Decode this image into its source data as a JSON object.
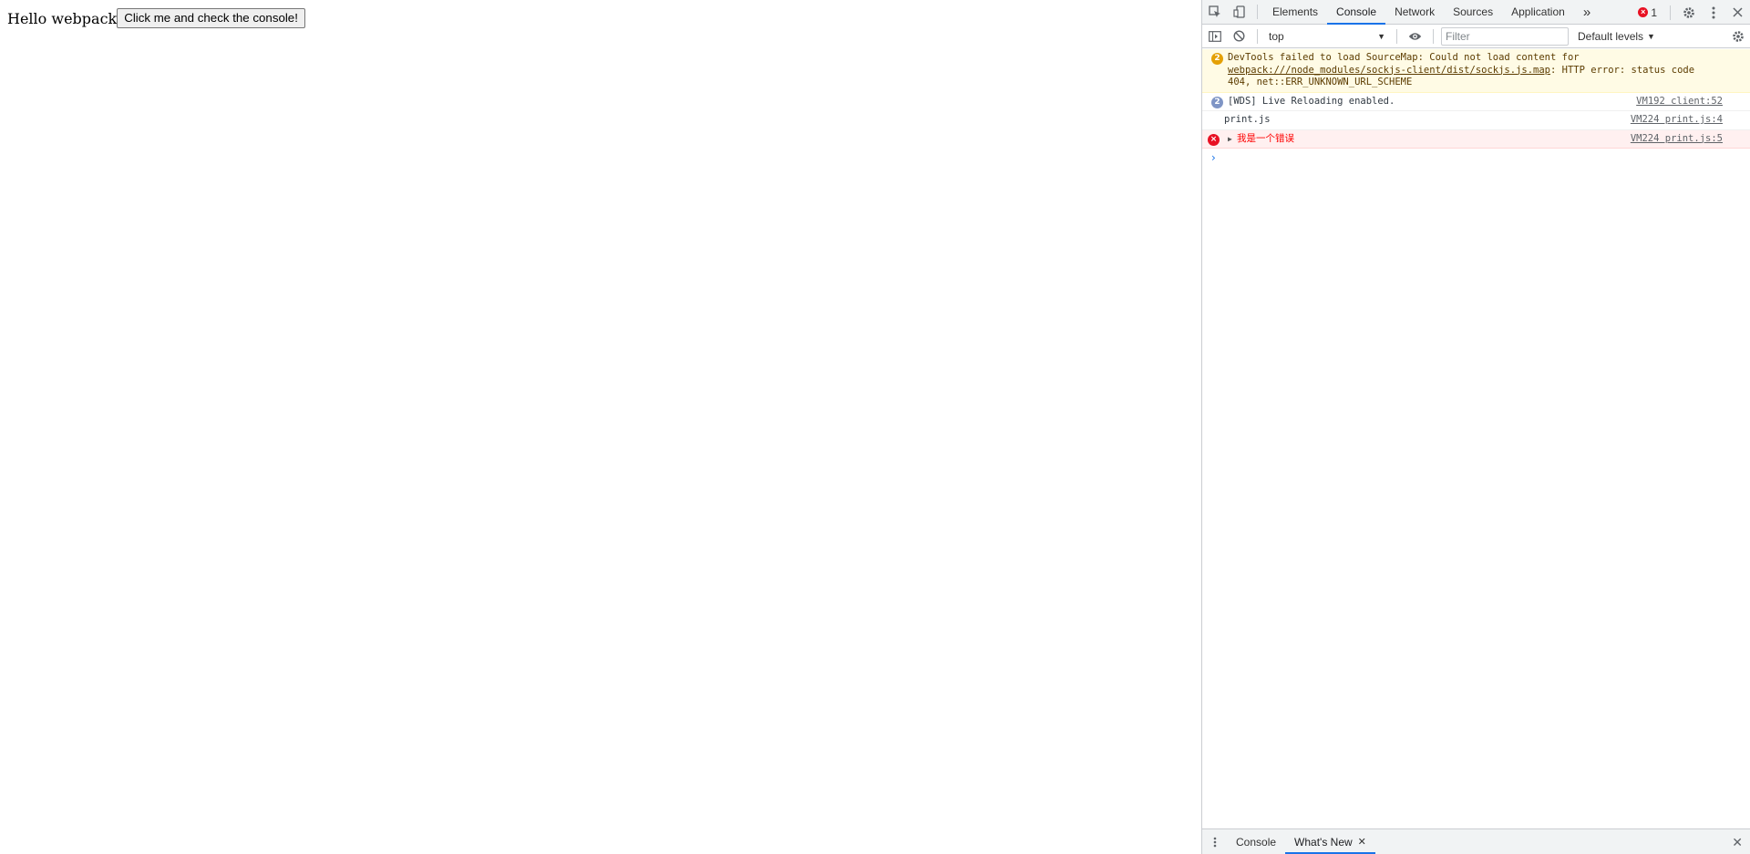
{
  "page": {
    "text": "Hello webpack",
    "button_label": "Click me and check the console!"
  },
  "devtools": {
    "tabs": [
      "Elements",
      "Console",
      "Network",
      "Sources",
      "Application"
    ],
    "active_tab": "Console",
    "overflow_label": "»",
    "error_badge_count": "1",
    "toolbar": {
      "context": "top",
      "filter_placeholder": "Filter",
      "levels_label": "Default levels"
    },
    "messages": [
      {
        "type": "warning",
        "count": "2",
        "text_prefix": "DevTools failed to load SourceMap: Could not load content for ",
        "link": "webpack:///node_modules/sockjs-client/dist/sockjs.js.map",
        "text_suffix": ": HTTP error: status code 404, net::ERR_UNKNOWN_URL_SCHEME"
      },
      {
        "type": "info",
        "count": "2",
        "text": "[WDS] Live Reloading enabled.",
        "source": "VM192 client:52"
      },
      {
        "type": "log",
        "text": "print.js",
        "source": "VM224 print.js:4"
      },
      {
        "type": "error",
        "text": "我是一个错误",
        "source": "VM224 print.js:5"
      }
    ],
    "prompt_symbol": "›",
    "drawer": {
      "tabs": [
        "Console",
        "What's New"
      ],
      "active_tab": "What's New"
    },
    "colors": {
      "accent": "#1a73e8",
      "error": "#e81123",
      "warning_badge": "#e4a006",
      "info_badge": "#7f95c5"
    }
  }
}
